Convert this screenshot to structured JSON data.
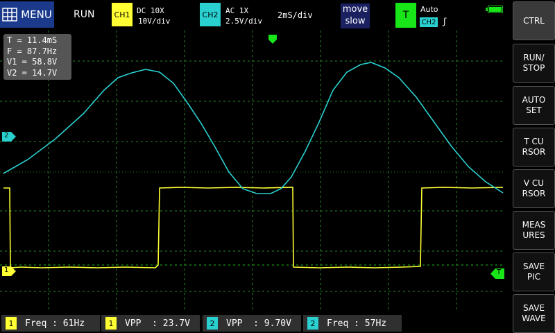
{
  "header": {
    "menu_label": "MENU",
    "run_state": "RUN",
    "ch1": {
      "label": "CH1",
      "coupling": "DC  10X",
      "scale": "10V/div",
      "color": "#ffff33"
    },
    "ch2": {
      "label": "CH2",
      "coupling": "AC  1X",
      "scale": "2.5V/div",
      "color": "#2ad0d0"
    },
    "timebase": "2mS/div",
    "move_label": {
      "line1": "move",
      "line2": "slow"
    },
    "trigger": {
      "label": "T",
      "mode": "Auto",
      "source": "CH2",
      "edge": "ʃ",
      "color": "#19e619"
    },
    "battery_icon": "battery-icon"
  },
  "sidebar": [
    {
      "id": "ctrl",
      "label": "CTRL"
    },
    {
      "id": "run-stop",
      "label": "RUN/\nSTOP"
    },
    {
      "id": "auto-set",
      "label": "AUTO\nSET"
    },
    {
      "id": "t-cursor",
      "label": "T CU\nRSOR"
    },
    {
      "id": "v-cursor",
      "label": "V CU\nRSOR"
    },
    {
      "id": "measures",
      "label": "MEAS\nURES"
    },
    {
      "id": "save-pic",
      "label": "SAVE\nPIC"
    },
    {
      "id": "save-wave",
      "label": "SAVE\nWAVE"
    }
  ],
  "cursor_info": {
    "t": "T = 11.4mS",
    "f": "F = 87.7Hz",
    "v1": "V1 = 58.8V",
    "v2": "V2 = 14.7V"
  },
  "markers": {
    "ch1": "1",
    "ch2": "2",
    "trigger": "T"
  },
  "measurements": [
    {
      "tag": "1",
      "text": "Freq : 61Hz"
    },
    {
      "tag": "1",
      "text": "VPP  : 23.7V"
    },
    {
      "tag": "2",
      "text": "VPP  : 9.70V"
    },
    {
      "tag": "2",
      "text": "Freq : 57Hz"
    }
  ]
}
